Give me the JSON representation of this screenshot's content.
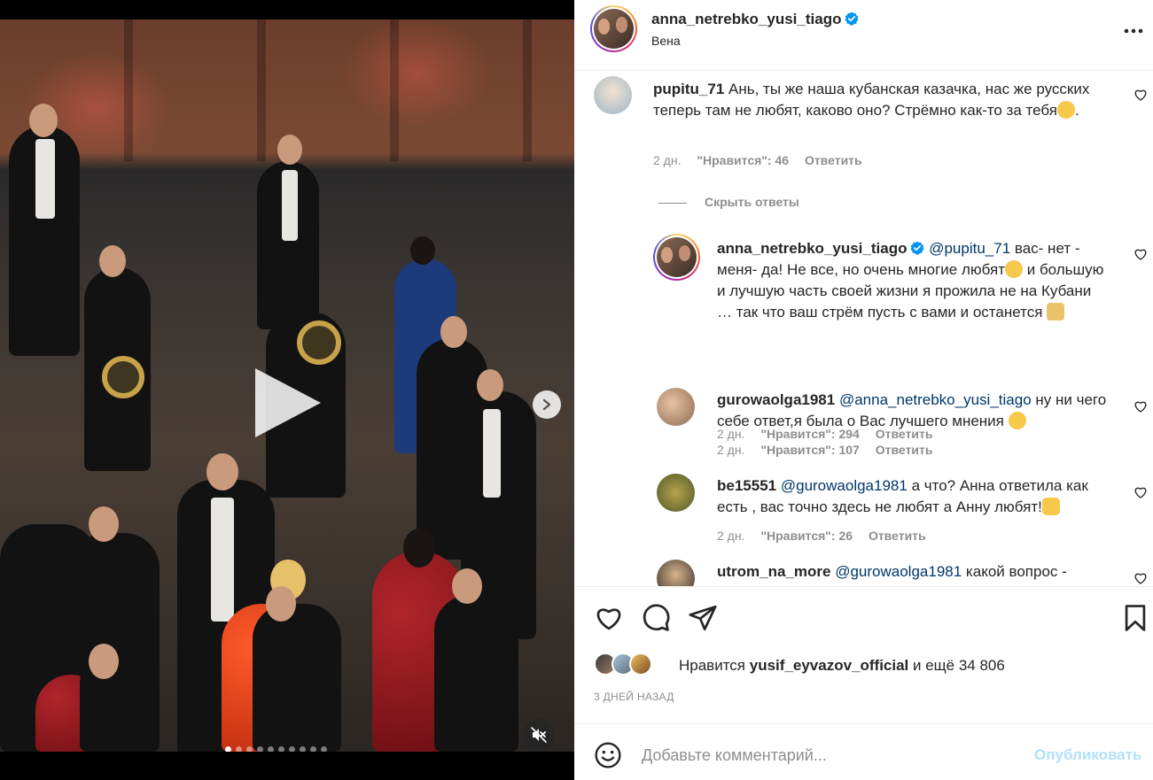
{
  "post": {
    "username": "anna_netrebko_yusi_tiago",
    "location": "Вена",
    "verified": true
  },
  "media": {
    "slide_count": 10,
    "active_slide": 1,
    "icons": {
      "play": "play-icon",
      "next": "chevron-right-icon",
      "mute": "speaker-muted-icon"
    }
  },
  "comments": [
    {
      "username": "pupitu_71",
      "text": "Ань, ты же наша кубанская казачка, нас же русских теперь там не любят, каково оно? Стрёмно как-то за тебя",
      "emoji": "😥",
      "emoji_after": ".",
      "time": "2 дн.",
      "likes": "\"Нравится\": 46",
      "reply": "Ответить"
    },
    {
      "hide_replies": "Скрыть ответы"
    },
    {
      "username": "anna_netrebko_yusi_tiago",
      "mention": "@pupitu_71",
      "text1": " вас- нет - меня- да! Не все, но очень многие любят",
      "emoji1": "🥳",
      "text2": " и большую и лучшую часть своей жизни я прожила не на Кубани … так что ваш стрём пусть с вами и останется ",
      "emoji2": "🥂",
      "time": "2 дн.",
      "likes": "\"Нравится\": 294",
      "reply": "Ответить"
    },
    {
      "username": "gurowaolga1981",
      "mention": "@anna_netrebko_yusi_tiago",
      "text": " ну ни чего себе ответ,я была о Вас лучшего мнения ",
      "emoji": "😳",
      "time": "2 дн.",
      "likes": "\"Нравится\": 107",
      "reply": "Ответить"
    },
    {
      "username": "be15551",
      "mention": "@gurowaolga1981",
      "text": " а что? Анна ответила как есть , вас точно здесь не любят а Анну любят!",
      "emoji": "👍",
      "time": "2 дн.",
      "likes": "\"Нравится\": 26",
      "reply": "Ответить"
    },
    {
      "username": "utrom_na_more",
      "mention": "@gurowaolga1981",
      "text": " какой вопрос -"
    }
  ],
  "likes": {
    "prefix": "Нравится ",
    "user": "yusif_eyvazov_official",
    "suffix": " и ещё 34 806"
  },
  "date": "3 ДНЕЙ НАЗАД",
  "add_comment": {
    "placeholder": "Добавьте комментарий...",
    "publish": "Опубликовать"
  },
  "colors": {
    "accent": "#0095f6",
    "publish_disabled": "#b2dffc",
    "mention": "#00376b",
    "muted": "#8e8e8e"
  }
}
